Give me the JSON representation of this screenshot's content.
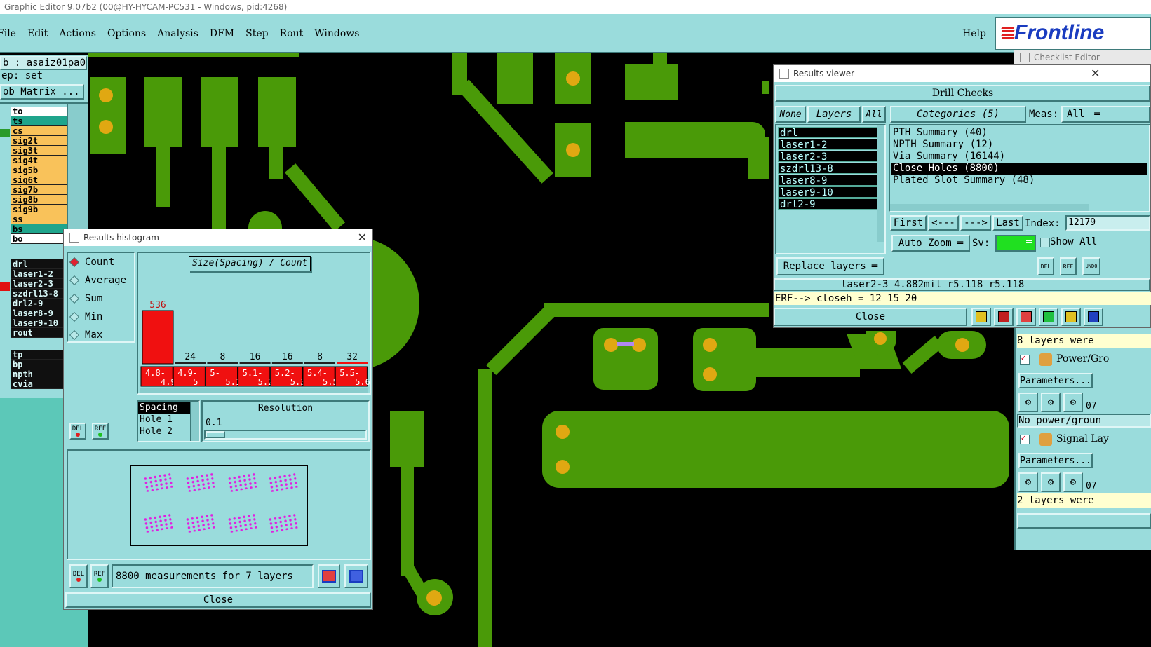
{
  "window_title": "Graphic Editor 9.07b2 (00@HY-HYCAM-PC531 - Windows, pid:4268)",
  "menu": [
    "File",
    "Edit",
    "Actions",
    "Options",
    "Analysis",
    "DFM",
    "Step",
    "Rout",
    "Windows"
  ],
  "help": "Help",
  "brand": "Frontline",
  "checklist_editor": "Checklist Editor",
  "left": {
    "job": "b : asaiz01pa0",
    "step": "ep: set",
    "matrix_button": "ob Matrix ...",
    "layers_group1": [
      {
        "name": "to",
        "color": "#ffffff"
      },
      {
        "name": "ts",
        "color": "#1fa58c"
      },
      {
        "name": "cs",
        "color": "#f9c25a"
      },
      {
        "name": "sig2t",
        "color": "#f9c25a"
      },
      {
        "name": "sig3t",
        "color": "#f9c25a"
      },
      {
        "name": "sig4t",
        "color": "#f9c25a"
      },
      {
        "name": "sig5b",
        "color": "#f9c25a"
      },
      {
        "name": "sig6t",
        "color": "#f9c25a"
      },
      {
        "name": "sig7b",
        "color": "#f9c25a"
      },
      {
        "name": "sig8b",
        "color": "#f9c25a"
      },
      {
        "name": "sig9b",
        "color": "#f9c25a"
      },
      {
        "name": "ss",
        "color": "#f9c25a"
      },
      {
        "name": "bs",
        "color": "#1fa58c"
      },
      {
        "name": "bo",
        "color": "#ffffff"
      }
    ],
    "layers_group2": [
      "drl",
      "laser1-2",
      "laser2-3",
      "szdrl13-8",
      "drl2-9",
      "laser8-9",
      "laser9-10",
      "rout"
    ],
    "layers_group3": [
      "tp",
      "bp",
      "npth",
      "cvia"
    ]
  },
  "histogram": {
    "title": "Results histogram",
    "options": [
      "Count",
      "Average",
      "Sum",
      "Min",
      "Max"
    ],
    "selected": "Count",
    "chart_title": "Size(Spacing) / Count",
    "del": "DEL",
    "ref": "REF",
    "spacing_list": [
      "Spacing",
      "Hole 1",
      "Hole 2"
    ],
    "resolution_label": "Resolution",
    "resolution_value": "0.1",
    "status": "8800 measurements for 7 layers",
    "close": "Close"
  },
  "chart_data": {
    "type": "bar",
    "title": "Size(Spacing) / Count",
    "categories": [
      "4.8-4.9",
      "4.9-5",
      "5-5.1",
      "5.1-5.2",
      "5.2-5.3",
      "5.4-5.5",
      "5.5-5.6"
    ],
    "values": [
      536,
      24,
      8,
      16,
      16,
      8,
      32
    ],
    "bar_color": "#f01010",
    "highlighted_category": "4.8-4.9"
  },
  "results": {
    "title": "Results viewer",
    "header": "Drill Checks",
    "none": "None",
    "layers": "Layers",
    "all": "All",
    "categories": "Categories (5)",
    "meas_label": "Meas:",
    "meas_value": "All",
    "layer_list": [
      "drl",
      "laser1-2",
      "laser2-3",
      "szdrl13-8",
      "laser8-9",
      "laser9-10",
      "drl2-9"
    ],
    "category_list": [
      "PTH Summary (40)",
      "NPTH Summary (12)",
      "Via Summary (16144)",
      "Close Holes (8800)",
      "Plated Slot Summary (48)"
    ],
    "selected_category": "Close Holes (8800)",
    "first": "First",
    "prev": "<---",
    "next": "--->",
    "last": "Last",
    "index_label": "Index:",
    "index_value": "12179",
    "auto_zoom": "Auto Zoom",
    "sv": "Sv:",
    "show_all": "Show All",
    "replace_layers": "Replace layers",
    "del": "DEL",
    "ref": "REF",
    "undo": "UNDO",
    "measure_line": "laser2-3 4.882mil   r5.118   r5.118",
    "erf_line": "ERF--> closeh = 12 15 20",
    "close": "Close"
  },
  "checklist": {
    "line1": "8 layers were",
    "power": "Power/Gro",
    "parameters": "Parameters...",
    "num07": "07",
    "no_power": "No power/groun",
    "signal": "Signal Lay",
    "line2": "2 layers were"
  }
}
